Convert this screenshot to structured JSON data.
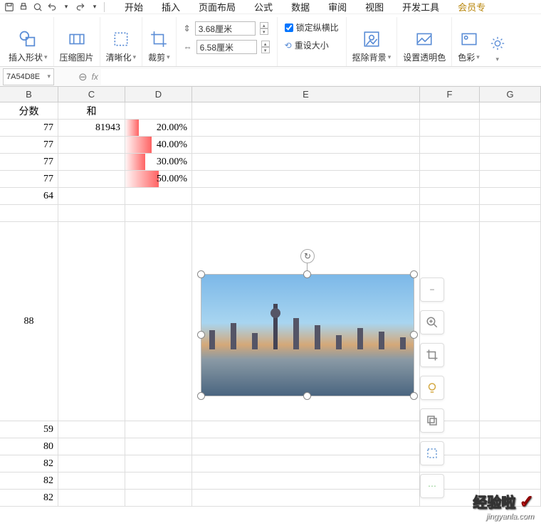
{
  "menu": {
    "tabs": [
      "开始",
      "插入",
      "页面布局",
      "公式",
      "数据",
      "审阅",
      "视图",
      "开发工具",
      "会员专"
    ]
  },
  "ribbon": {
    "insertShape": "插入形状",
    "compress": "压缩图片",
    "clarity": "清晰化",
    "crop": "裁剪",
    "height": "3.68厘米",
    "width": "6.58厘米",
    "lockRatio": "锁定纵横比",
    "resetSize": "重设大小",
    "removeBg": "抠除背景",
    "transparency": "设置透明色",
    "color": "色彩",
    "brightness": ""
  },
  "namebox": "7A54D8E",
  "fx": "fx",
  "columns": [
    "B",
    "C",
    "D",
    "E",
    "F",
    "G"
  ],
  "headers": {
    "B": "分数",
    "C": "和",
    "D": "",
    "E": "",
    "F": "",
    "G": ""
  },
  "rows": [
    {
      "B": "77",
      "C": "81943",
      "D": "20.00%",
      "Dbar": 20
    },
    {
      "B": "77",
      "C": "",
      "D": "40.00%",
      "Dbar": 40
    },
    {
      "B": "77",
      "C": "",
      "D": "30.00%",
      "Dbar": 30
    },
    {
      "B": "77",
      "C": "",
      "D": "50.00%",
      "Dbar": 50
    },
    {
      "B": "64",
      "C": "",
      "D": ""
    },
    {
      "B": "",
      "C": "",
      "D": "",
      "tallAfter": true
    },
    {
      "B": "88",
      "C": "",
      "D": "",
      "tall": true
    },
    {
      "B": "59",
      "C": "",
      "D": ""
    },
    {
      "B": "80",
      "C": "",
      "D": ""
    },
    {
      "B": "82",
      "C": "",
      "D": ""
    },
    {
      "B": "82",
      "C": "",
      "D": ""
    },
    {
      "B": "82",
      "C": "",
      "D": ""
    }
  ],
  "watermark": {
    "main": "经验啦",
    "url": "jingyanla.com"
  },
  "icons": {
    "minus": "−",
    "plus": "＋",
    "crop": "▢",
    "bulb": "◐",
    "layer": "⧉",
    "select": "⬚",
    "more": "⋯"
  }
}
